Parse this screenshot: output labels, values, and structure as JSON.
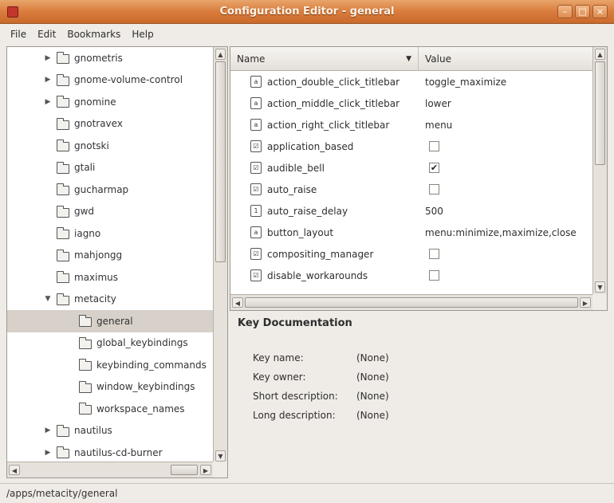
{
  "window": {
    "title": "Configuration Editor - general",
    "minimize_glyph": "–",
    "maximize_glyph": "□",
    "close_glyph": "×"
  },
  "menubar": [
    "File",
    "Edit",
    "Bookmarks",
    "Help"
  ],
  "tree": {
    "items": [
      {
        "label": "gnometris",
        "level": 1,
        "expander": "collapsed"
      },
      {
        "label": "gnome-volume-control",
        "level": 1,
        "expander": "collapsed"
      },
      {
        "label": "gnomine",
        "level": 1,
        "expander": "collapsed"
      },
      {
        "label": "gnotravex",
        "level": 1,
        "expander": "none"
      },
      {
        "label": "gnotski",
        "level": 1,
        "expander": "none"
      },
      {
        "label": "gtali",
        "level": 1,
        "expander": "none"
      },
      {
        "label": "gucharmap",
        "level": 1,
        "expander": "none"
      },
      {
        "label": "gwd",
        "level": 1,
        "expander": "none"
      },
      {
        "label": "iagno",
        "level": 1,
        "expander": "none"
      },
      {
        "label": "mahjongg",
        "level": 1,
        "expander": "none"
      },
      {
        "label": "maximus",
        "level": 1,
        "expander": "none"
      },
      {
        "label": "metacity",
        "level": 1,
        "expander": "expanded"
      },
      {
        "label": "general",
        "level": 2,
        "expander": "none",
        "selected": true
      },
      {
        "label": "global_keybindings",
        "level": 2,
        "expander": "none"
      },
      {
        "label": "keybinding_commands",
        "level": 2,
        "expander": "none"
      },
      {
        "label": "window_keybindings",
        "level": 2,
        "expander": "none"
      },
      {
        "label": "workspace_names",
        "level": 2,
        "expander": "none"
      },
      {
        "label": "nautilus",
        "level": 1,
        "expander": "collapsed"
      },
      {
        "label": "nautilus-cd-burner",
        "level": 1,
        "expander": "collapsed"
      }
    ]
  },
  "keys": {
    "columns": {
      "name": "Name",
      "value": "Value"
    },
    "rows": [
      {
        "name": "action_double_click_titlebar",
        "value": "toggle_maximize",
        "type": "string"
      },
      {
        "name": "action_middle_click_titlebar",
        "value": "lower",
        "type": "string"
      },
      {
        "name": "action_right_click_titlebar",
        "value": "menu",
        "type": "string"
      },
      {
        "name": "application_based",
        "value": "",
        "type": "bool",
        "checked": false
      },
      {
        "name": "audible_bell",
        "value": "",
        "type": "bool",
        "checked": true
      },
      {
        "name": "auto_raise",
        "value": "",
        "type": "bool",
        "checked": false
      },
      {
        "name": "auto_raise_delay",
        "value": "500",
        "type": "int"
      },
      {
        "name": "button_layout",
        "value": "menu:minimize,maximize,close",
        "type": "string"
      },
      {
        "name": "compositing_manager",
        "value": "",
        "type": "bool",
        "checked": false
      },
      {
        "name": "disable_workarounds",
        "value": "",
        "type": "bool",
        "checked": false
      }
    ]
  },
  "documentation": {
    "title": "Key Documentation",
    "fields": [
      {
        "label": "Key name:",
        "value": "(None)"
      },
      {
        "label": "Key owner:",
        "value": "(None)"
      },
      {
        "label": "Short description:",
        "value": "(None)"
      },
      {
        "label": "Long description:",
        "value": "(None)"
      }
    ]
  },
  "status": {
    "path": "/apps/metacity/general"
  }
}
